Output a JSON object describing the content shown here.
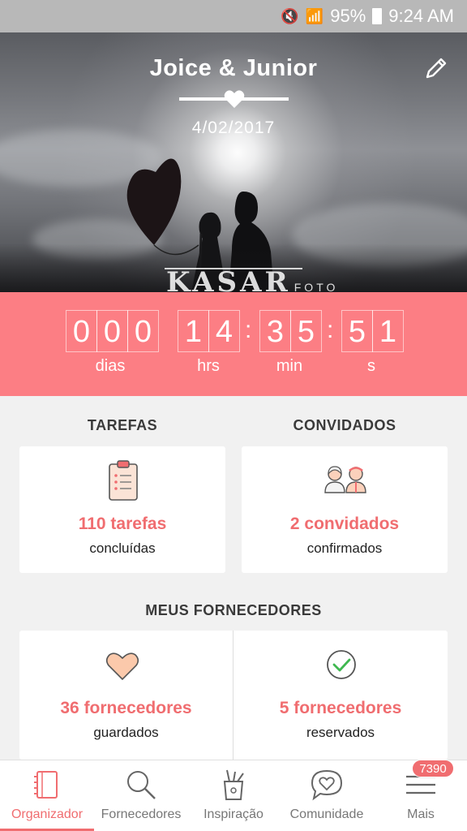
{
  "status_bar": {
    "battery": "95%",
    "time": "9:24 AM"
  },
  "hero": {
    "title": "Joice & Junior",
    "date": "4/02/2017",
    "watermark_big": "KASAR",
    "watermark_small": "FOTO"
  },
  "countdown": {
    "days": [
      "0",
      "0",
      "0"
    ],
    "hours": [
      "1",
      "4"
    ],
    "minutes": [
      "3",
      "5"
    ],
    "seconds": [
      "5",
      "1"
    ],
    "labels": {
      "days": "dias",
      "hours": "hrs",
      "minutes": "min",
      "seconds": "s"
    }
  },
  "sections": {
    "tasks": {
      "title": "TAREFAS",
      "value": "110 tarefas",
      "sub": "concluídas",
      "icon": "clipboard-icon"
    },
    "guests": {
      "title": "CONVIDADOS",
      "value": "2 convidados",
      "sub": "confirmados",
      "icon": "guests-icon"
    },
    "suppliers": {
      "title": "MEUS FORNECEDORES",
      "saved": {
        "value": "36 fornecedores",
        "sub": "guardados",
        "icon": "heart-icon"
      },
      "booked": {
        "value": "5 fornecedores",
        "sub": "reservados",
        "icon": "check-circle-icon"
      }
    }
  },
  "nav": {
    "items": [
      {
        "label": "Organizador",
        "icon": "notebook-icon",
        "active": true
      },
      {
        "label": "Fornecedores",
        "icon": "search-icon",
        "active": false
      },
      {
        "label": "Inspiração",
        "icon": "pencil-cup-icon",
        "active": false
      },
      {
        "label": "Comunidade",
        "icon": "chat-heart-icon",
        "active": false
      },
      {
        "label": "Mais",
        "icon": "menu-icon",
        "active": false
      }
    ],
    "badge": "7390"
  },
  "colors": {
    "accent": "#f06d70",
    "countdown_bg": "#fc7e84",
    "page_bg": "#f1f1f1"
  }
}
